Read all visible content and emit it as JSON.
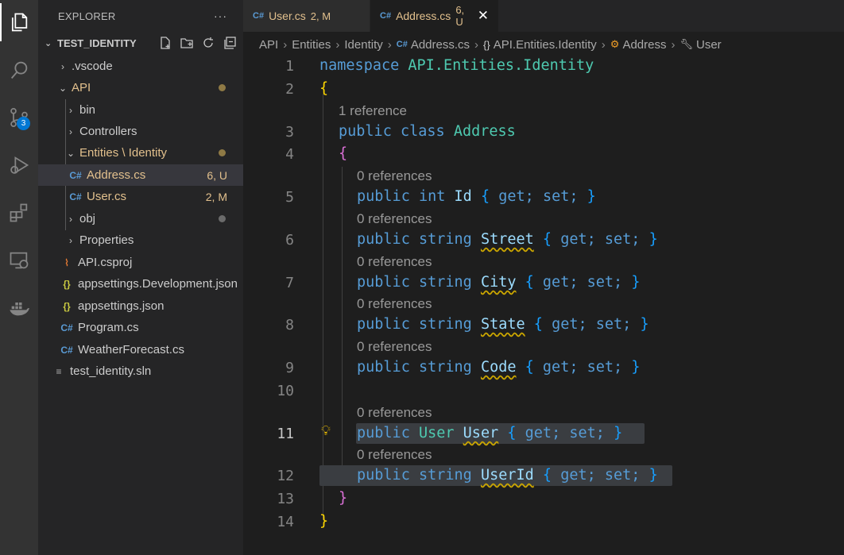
{
  "activity_bar": {
    "items": [
      {
        "name": "explorer-icon"
      },
      {
        "name": "search-icon"
      },
      {
        "name": "source-control-icon",
        "badge": "3"
      },
      {
        "name": "run-debug-icon"
      },
      {
        "name": "extensions-icon"
      },
      {
        "name": "remote-explorer-icon"
      },
      {
        "name": "docker-icon"
      }
    ]
  },
  "sidebar": {
    "title": "EXPLORER",
    "more": "···",
    "section": "TEST_IDENTITY",
    "tree": [
      {
        "label": ".vscode",
        "type": "folder",
        "expanded": false
      },
      {
        "label": "API",
        "type": "folder",
        "expanded": true
      },
      {
        "label": "bin",
        "type": "folder",
        "expanded": false
      },
      {
        "label": "Controllers",
        "type": "folder",
        "expanded": false
      },
      {
        "label": "Entities \\ Identity",
        "type": "folder",
        "expanded": true
      },
      {
        "label": "Address.cs",
        "type": "cs",
        "status": "6, U"
      },
      {
        "label": "User.cs",
        "type": "cs",
        "status": "2, M"
      },
      {
        "label": "obj",
        "type": "folder",
        "expanded": false
      },
      {
        "label": "Properties",
        "type": "folder",
        "expanded": false
      },
      {
        "label": "API.csproj",
        "type": "rss"
      },
      {
        "label": "appsettings.Development.json",
        "type": "json"
      },
      {
        "label": "appsettings.json",
        "type": "json"
      },
      {
        "label": "Program.cs",
        "type": "cs"
      },
      {
        "label": "WeatherForecast.cs",
        "type": "cs"
      },
      {
        "label": "test_identity.sln",
        "type": "sln"
      }
    ]
  },
  "tabs": [
    {
      "label": "User.cs",
      "status": "2, M",
      "active": false
    },
    {
      "label": "Address.cs",
      "status": "6, U",
      "active": true,
      "close": "✕"
    }
  ],
  "breadcrumbs": {
    "api": "API",
    "entities": "Entities",
    "identity": "Identity",
    "file": "Address.cs",
    "namespace": "API.Entities.Identity",
    "class": "Address",
    "member": "User"
  },
  "editor": {
    "line_numbers": [
      "1",
      "2",
      "3",
      "4",
      "5",
      "6",
      "7",
      "8",
      "9",
      "10",
      "11",
      "12",
      "13",
      "14"
    ],
    "code_lens": {
      "class_refs": "1 reference",
      "zero_refs": "0 references"
    },
    "code": {
      "namespace_kw": "namespace",
      "namespace_name": "API.Entities.Identity",
      "public": "public",
      "class": "class",
      "class_name": "Address",
      "int": "int",
      "string": "string",
      "get": "get;",
      "set": "set;",
      "props": [
        "Id",
        "Street",
        "City",
        "State",
        "Code"
      ],
      "user_type": "User",
      "user_prop": "User",
      "userid_prop": "UserId"
    }
  },
  "colors": {
    "keyword": "#569cd6",
    "type": "#4ec9b0",
    "property": "#9cdcfe",
    "modified": "#e2c08d",
    "accent": "#0078d4"
  }
}
